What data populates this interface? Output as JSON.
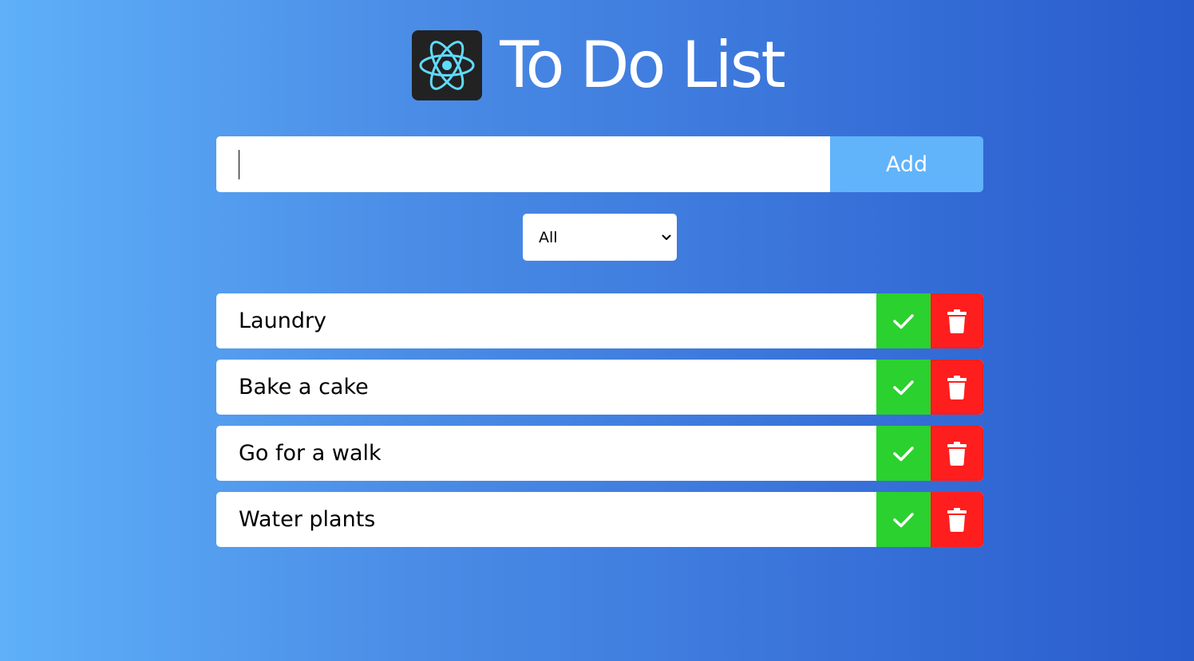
{
  "header": {
    "title": "To Do List",
    "logo_icon": "react-atom-icon"
  },
  "form": {
    "input_value": "",
    "input_placeholder": "",
    "add_label": "Add"
  },
  "filter": {
    "selected": "All"
  },
  "todos": [
    {
      "text": "Laundry"
    },
    {
      "text": "Bake a cake"
    },
    {
      "text": "Go for a walk"
    },
    {
      "text": "Water plants"
    }
  ],
  "colors": {
    "complete": "#2bd12e",
    "delete": "#ff1e1e",
    "add": "#61b3fa",
    "logo_bg": "#222222",
    "react_blue": "#61dafb"
  }
}
